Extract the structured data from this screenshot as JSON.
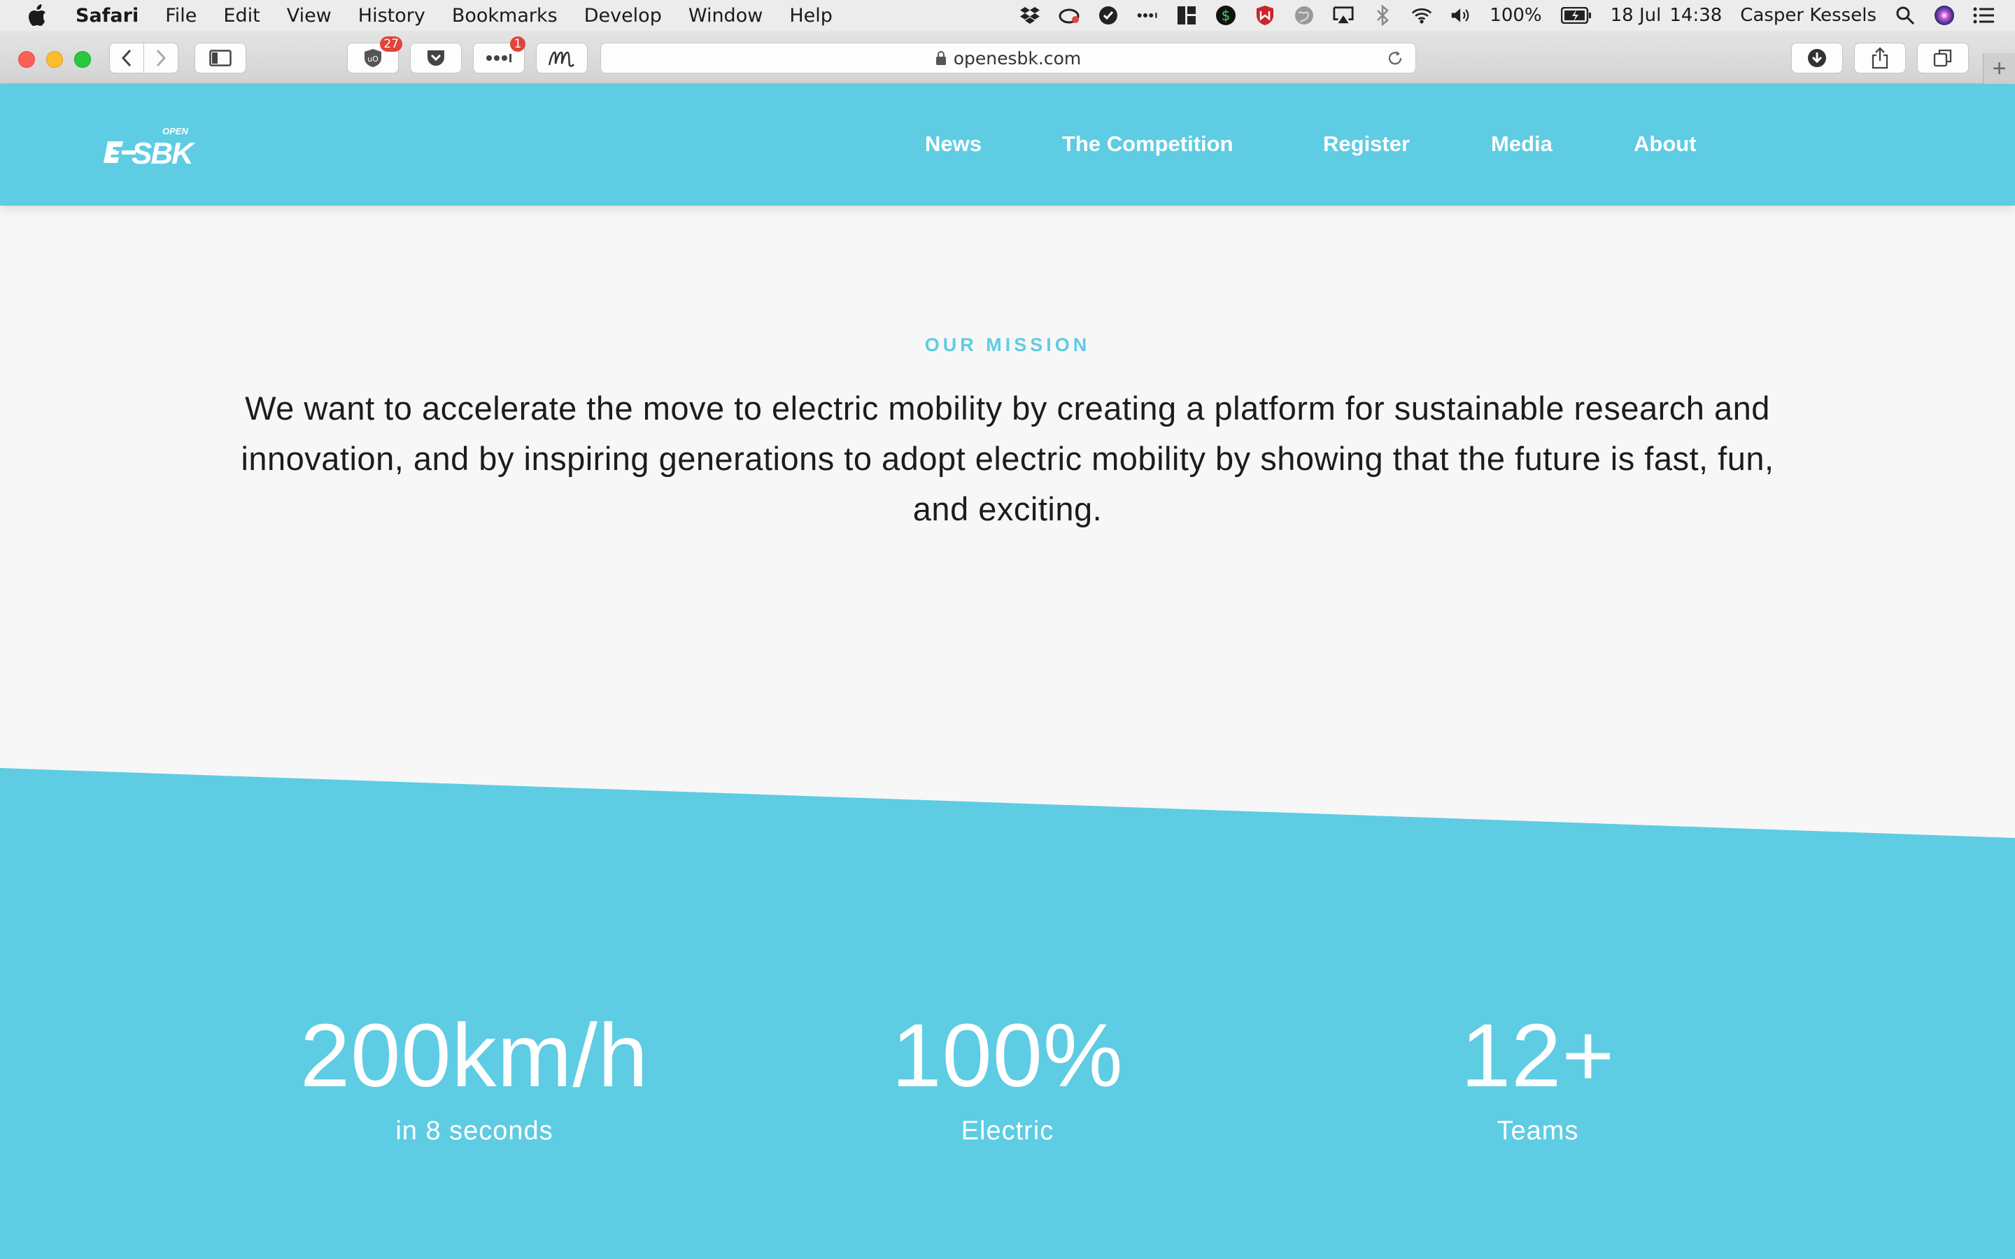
{
  "menubar": {
    "app_name": "Safari",
    "items": [
      "File",
      "Edit",
      "View",
      "History",
      "Bookmarks",
      "Develop",
      "Window",
      "Help"
    ],
    "battery": "100%",
    "date": "18 Jul",
    "time": "14:38",
    "user": "Casper Kessels"
  },
  "browser": {
    "url": "openesbk.com",
    "extension_badge_1": "27",
    "extension_badge_2": "1"
  },
  "site": {
    "logo_top": "OPEN",
    "logo_main": "E SBK",
    "nav": [
      "News",
      "The Competition",
      "Register",
      "Media",
      "About"
    ],
    "mission_label": "OUR MISSION",
    "mission_text": "We want to accelerate the move to electric mobility by creating a platform for sustainable research and innovation, and by inspiring generations to adopt electric mobility by showing that the future is fast, fun, and exciting.",
    "stats": [
      {
        "value": "200km/h",
        "caption": "in 8 seconds"
      },
      {
        "value": "100%",
        "caption": "Electric"
      },
      {
        "value": "12+",
        "caption": "Teams"
      }
    ]
  },
  "colors": {
    "brand": "#5ecce3",
    "page_bg": "#f7f7f7",
    "text": "#1c1c1c"
  }
}
